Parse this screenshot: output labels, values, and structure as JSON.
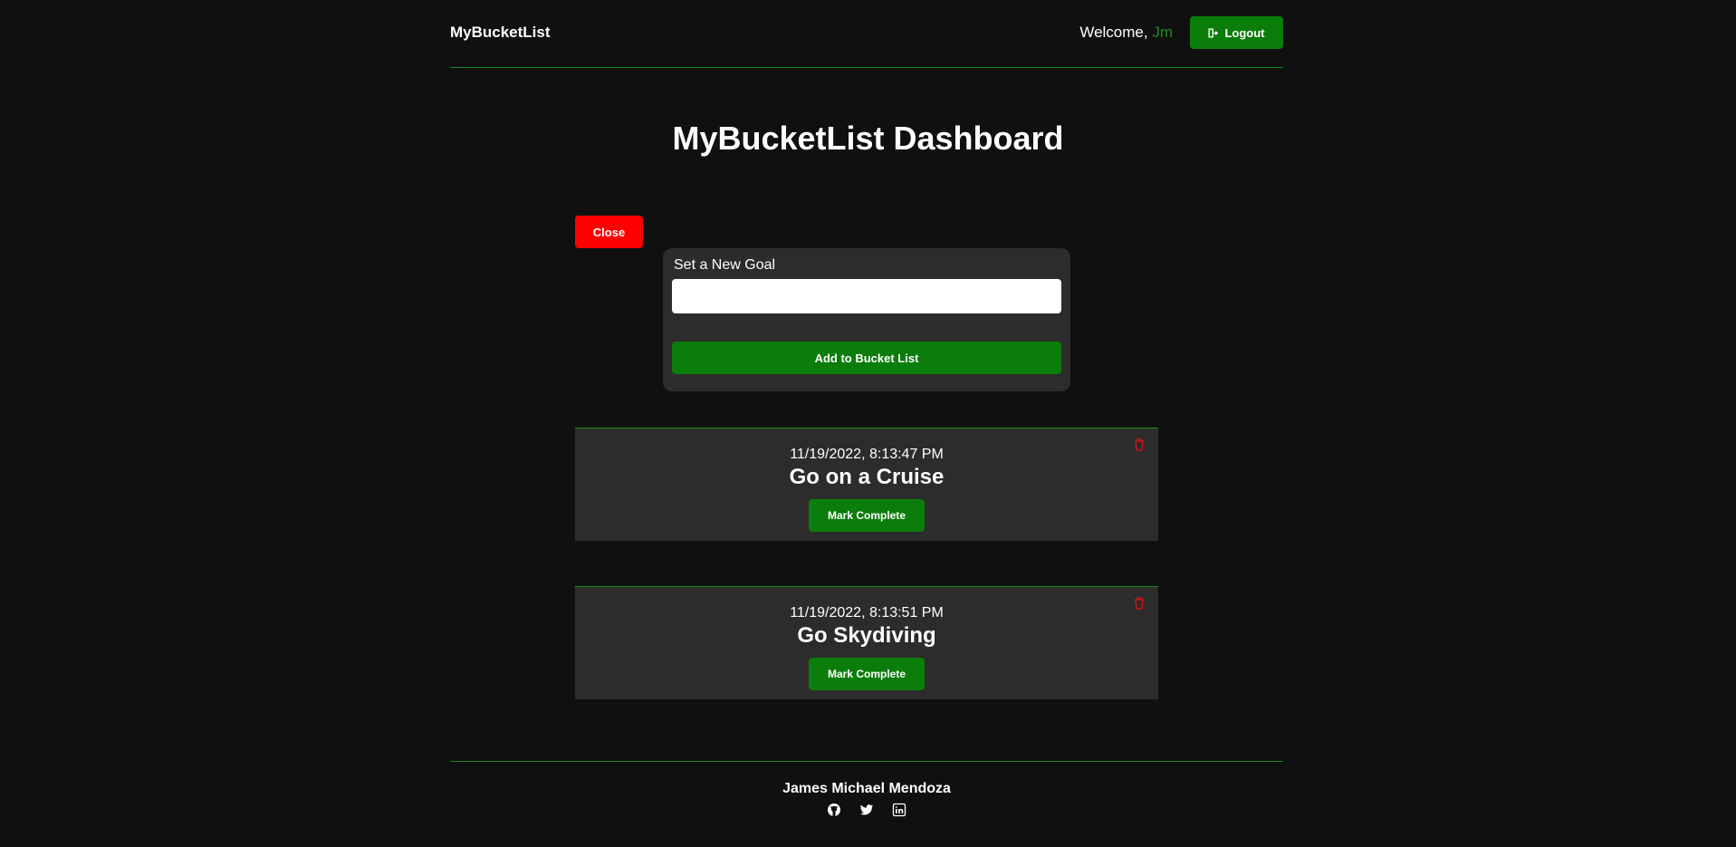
{
  "header": {
    "brand": "MyBucketList",
    "welcome_prefix": "Welcome, ",
    "username": "Jm",
    "logout_label": "Logout"
  },
  "main": {
    "title": "MyBucketList Dashboard",
    "close_label": "Close",
    "form": {
      "label": "Set a New Goal",
      "input_value": "",
      "submit_label": "Add to Bucket List"
    },
    "goals": [
      {
        "timestamp": "11/19/2022, 8:13:47 PM",
        "title": "Go on a Cruise",
        "action_label": "Mark Complete"
      },
      {
        "timestamp": "11/19/2022, 8:13:51 PM",
        "title": "Go Skydiving",
        "action_label": "Mark Complete"
      }
    ]
  },
  "footer": {
    "name": "James Michael Mendoza",
    "social": [
      "github-icon",
      "twitter-icon",
      "linkedin-icon"
    ]
  },
  "colors": {
    "background": "#101010",
    "accent_green": "#0b7d0b",
    "username_green": "#1f8f1f",
    "divider_green": "#1a8a1a",
    "danger_red": "#ff0000",
    "panel": "#2c2c2c"
  }
}
